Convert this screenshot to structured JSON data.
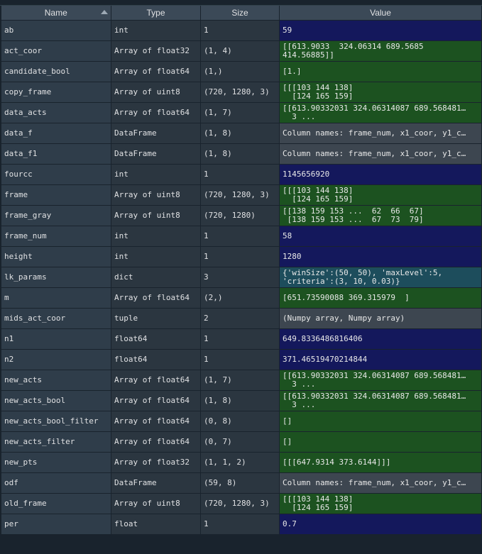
{
  "headers": {
    "name": "Name",
    "type": "Type",
    "size": "Size",
    "value": "Value"
  },
  "colors": {
    "navy": "#14185c",
    "green": "#1c5220",
    "teal": "#1d4d5c",
    "gray": "#3d4650"
  },
  "rows": [
    {
      "name": "ab",
      "type": "int",
      "size": "1",
      "value": "59",
      "color": "navy"
    },
    {
      "name": "act_coor",
      "type": "Array of float32",
      "size": "(1, 4)",
      "value": "[[613.9033  324.06314 689.5685\n414.56885]]",
      "color": "green"
    },
    {
      "name": "candidate_bool",
      "type": "Array of float64",
      "size": "(1,)",
      "value": "[1.]",
      "color": "green"
    },
    {
      "name": "copy_frame",
      "type": "Array of uint8",
      "size": "(720, 1280, 3)",
      "value": "[[[103 144 138]\n  [124 165 159]",
      "color": "green"
    },
    {
      "name": "data_acts",
      "type": "Array of float64",
      "size": "(1, 7)",
      "value": "[[613.90332031 324.06314087 689.568481…\n  3 ...",
      "color": "green"
    },
    {
      "name": "data_f",
      "type": "DataFrame",
      "size": "(1, 8)",
      "value": "Column names: frame_num, x1_coor, y1_c…",
      "color": "gray"
    },
    {
      "name": "data_f1",
      "type": "DataFrame",
      "size": "(1, 8)",
      "value": "Column names: frame_num, x1_coor, y1_c…",
      "color": "gray"
    },
    {
      "name": "fourcc",
      "type": "int",
      "size": "1",
      "value": "1145656920",
      "color": "navy"
    },
    {
      "name": "frame",
      "type": "Array of uint8",
      "size": "(720, 1280, 3)",
      "value": "[[[103 144 138]\n  [124 165 159]",
      "color": "green"
    },
    {
      "name": "frame_gray",
      "type": "Array of uint8",
      "size": "(720, 1280)",
      "value": "[[138 159 153 ...  62  66  67]\n [138 159 153 ...  67  73  79]",
      "color": "green"
    },
    {
      "name": "frame_num",
      "type": "int",
      "size": "1",
      "value": "58",
      "color": "navy"
    },
    {
      "name": "height",
      "type": "int",
      "size": "1",
      "value": "1280",
      "color": "navy"
    },
    {
      "name": "lk_params",
      "type": "dict",
      "size": "3",
      "value": "{'winSize':(50, 50), 'maxLevel':5,\n'criteria':(3, 10, 0.03)}",
      "color": "teal"
    },
    {
      "name": "m",
      "type": "Array of float64",
      "size": "(2,)",
      "value": "[651.73590088 369.315979  ]",
      "color": "green"
    },
    {
      "name": "mids_act_coor",
      "type": "tuple",
      "size": "2",
      "value": "(Numpy array, Numpy array)",
      "color": "gray"
    },
    {
      "name": "n1",
      "type": "float64",
      "size": "1",
      "value": "649.8336486816406",
      "color": "navy"
    },
    {
      "name": "n2",
      "type": "float64",
      "size": "1",
      "value": "371.46519470214844",
      "color": "navy"
    },
    {
      "name": "new_acts",
      "type": "Array of float64",
      "size": "(1, 7)",
      "value": "[[613.90332031 324.06314087 689.568481…\n  3 ...",
      "color": "green"
    },
    {
      "name": "new_acts_bool",
      "type": "Array of float64",
      "size": "(1, 8)",
      "value": "[[613.90332031 324.06314087 689.568481…\n  3 ...",
      "color": "green"
    },
    {
      "name": "new_acts_bool_filter",
      "type": "Array of float64",
      "size": "(0, 8)",
      "value": "[]",
      "color": "green"
    },
    {
      "name": "new_acts_filter",
      "type": "Array of float64",
      "size": "(0, 7)",
      "value": "[]",
      "color": "green"
    },
    {
      "name": "new_pts",
      "type": "Array of float32",
      "size": "(1, 1, 2)",
      "value": "[[[647.9314 373.6144]]]",
      "color": "green"
    },
    {
      "name": "odf",
      "type": "DataFrame",
      "size": "(59, 8)",
      "value": "Column names: frame_num, x1_coor, y1_c…",
      "color": "gray"
    },
    {
      "name": "old_frame",
      "type": "Array of uint8",
      "size": "(720, 1280, 3)",
      "value": "[[[103 144 138]\n  [124 165 159]",
      "color": "green"
    },
    {
      "name": "per",
      "type": "float",
      "size": "1",
      "value": "0.7",
      "color": "navy"
    }
  ]
}
